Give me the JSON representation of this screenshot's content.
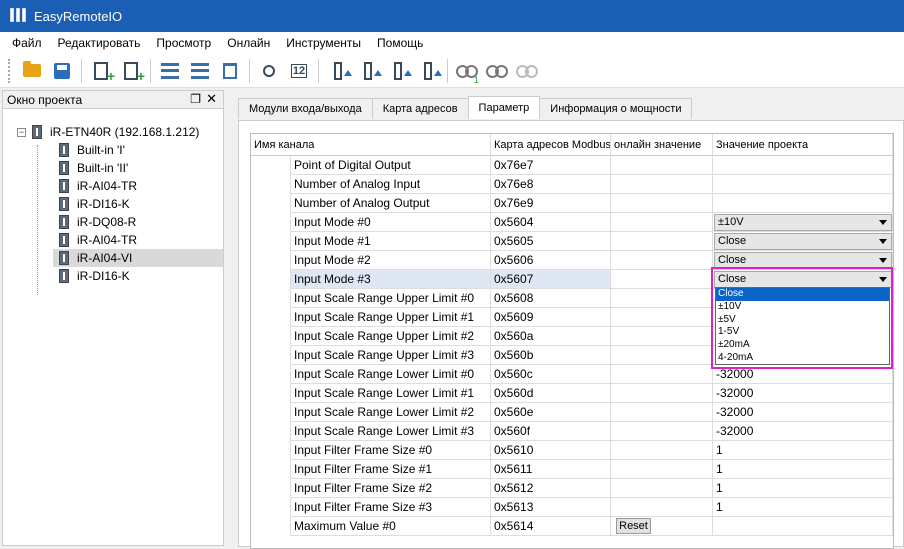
{
  "window": {
    "title": "EasyRemoteIO"
  },
  "menu": [
    "Файл",
    "Редактировать",
    "Просмотр",
    "Онлайн",
    "Инструменты",
    "Помощь"
  ],
  "toolbar": {
    "icons": [
      "open-folder-icon",
      "save-icon",
      "add-module-icon",
      "add-module-2-icon",
      "move-up-icon",
      "move-down-icon",
      "delete-icon",
      "search-icon",
      "numbering-icon",
      "column-up-icon",
      "column-multi-up-icon",
      "column-down-icon",
      "column-multi-down-icon",
      "connect-icon",
      "connect-run-icon",
      "disconnect-icon"
    ],
    "connect_sub": "1"
  },
  "project_panel": {
    "title": "Окно проекта",
    "pin": "❐",
    "close": "✕",
    "root": "iR-ETN40R (192.168.1.212)",
    "items": [
      "Built-in 'I'",
      "Built-in 'II'",
      "iR-AI04-TR",
      "iR-DI16-K",
      "iR-DQ08-R",
      "iR-AI04-TR",
      "iR-AI04-VI",
      "iR-DI16-K"
    ],
    "selected_index": 6
  },
  "tabs": [
    "Модули входа/выхода",
    "Карта адресов",
    "Параметр",
    "Информация о мощности"
  ],
  "active_tab": 2,
  "grid": {
    "headers": [
      "Имя канала",
      "Карта адресов Modbus",
      "онлайн значение",
      "Значение проекта"
    ],
    "rows": [
      {
        "name": "Point of Digital Output",
        "addr": "0x76e7",
        "online": "",
        "project": ""
      },
      {
        "name": "Number of Analog Input",
        "addr": "0x76e8",
        "online": "",
        "project": ""
      },
      {
        "name": "Number of Analog Output",
        "addr": "0x76e9",
        "online": "",
        "project": ""
      },
      {
        "name": "Input Mode #0",
        "addr": "0x5604",
        "online": "",
        "project": "±10V",
        "combo": true
      },
      {
        "name": "Input Mode #1",
        "addr": "0x5605",
        "online": "",
        "project": "Close",
        "combo": true
      },
      {
        "name": "Input Mode #2",
        "addr": "0x5606",
        "online": "",
        "project": "Close",
        "combo": true
      },
      {
        "name": "Input Mode #3",
        "addr": "0x5607",
        "online": "",
        "project": "Close",
        "combo": true,
        "selected": true
      },
      {
        "name": "Input Scale Range Upper Limit #0",
        "addr": "0x5608",
        "online": "",
        "project": ""
      },
      {
        "name": "Input Scale Range Upper Limit #1",
        "addr": "0x5609",
        "online": "",
        "project": ""
      },
      {
        "name": "Input Scale Range Upper Limit #2",
        "addr": "0x560a",
        "online": "",
        "project": ""
      },
      {
        "name": "Input Scale Range Upper Limit #3",
        "addr": "0x560b",
        "online": "",
        "project": ""
      },
      {
        "name": "Input Scale Range Lower Limit #0",
        "addr": "0x560c",
        "online": "",
        "project": "-32000"
      },
      {
        "name": "Input Scale Range Lower Limit #1",
        "addr": "0x560d",
        "online": "",
        "project": "-32000"
      },
      {
        "name": "Input Scale Range Lower Limit #2",
        "addr": "0x560e",
        "online": "",
        "project": "-32000"
      },
      {
        "name": "Input Scale Range Lower Limit #3",
        "addr": "0x560f",
        "online": "",
        "project": "-32000"
      },
      {
        "name": "Input Filter Frame Size #0",
        "addr": "0x5610",
        "online": "",
        "project": "1"
      },
      {
        "name": "Input Filter Frame Size #1",
        "addr": "0x5611",
        "online": "",
        "project": "1"
      },
      {
        "name": "Input Filter Frame Size #2",
        "addr": "0x5612",
        "online": "",
        "project": "1"
      },
      {
        "name": "Input Filter Frame Size #3",
        "addr": "0x5613",
        "online": "",
        "project": "1"
      },
      {
        "name": "Maximum Value #0",
        "addr": "0x5614",
        "online": "Reset",
        "project": "",
        "reset": true
      }
    ]
  },
  "dropdown": {
    "options": [
      "Close",
      "±10V",
      "±5V",
      "1-5V",
      "±20mA",
      "4-20mA"
    ],
    "highlighted_index": 0
  },
  "colors": {
    "titlebar": "#1a5fb4",
    "highlight_border": "#e020c8",
    "selection": "#0a64c8"
  }
}
